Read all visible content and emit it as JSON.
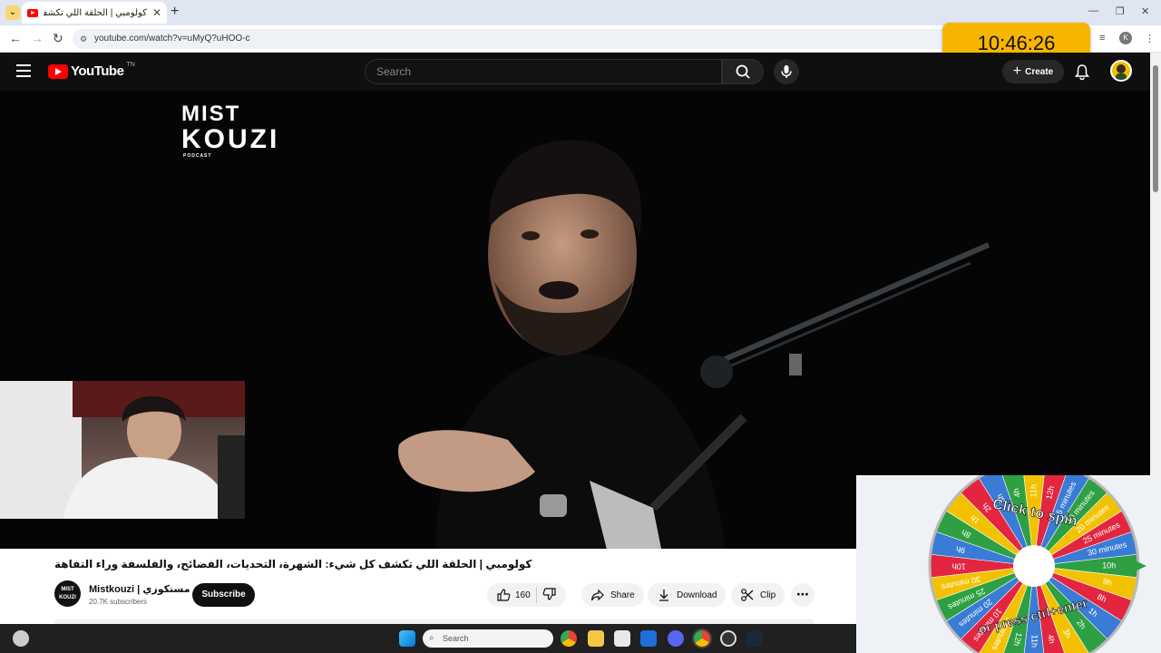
{
  "browser": {
    "tab_title": "كولومبي | الحلقة اللي تكشف كل شيء",
    "tab_close": "✕",
    "new_tab": "+",
    "url": "youtube.com/watch?v=uMyQ?uHOO-c",
    "profile_initial": "K"
  },
  "clock": {
    "time": "10:46:26"
  },
  "youtube": {
    "logo_text": "YouTube",
    "logo_badge": "TN",
    "search_placeholder": "Search",
    "create_label": "Create"
  },
  "video": {
    "watermark_line1": "MIST",
    "watermark_line2": "KOUZI",
    "watermark_line3": "PODCAST"
  },
  "details": {
    "title": "كولومبي | الحلقة اللي تكشف كل شيء: الشهرة، التحديات، الفضائح، والفلسفة وراء التفاهة",
    "channel_name": "Mistkouzi | مستكوزي",
    "channel_avatar_l1": "MIST",
    "channel_avatar_l2": "KOUZI",
    "subscribers": "20.7K subscribers",
    "subscribe_label": "Subscribe",
    "likes": "160",
    "share_label": "Share",
    "download_label": "Download",
    "clip_label": "Clip"
  },
  "wheel": {
    "top_text": "Click to spin",
    "bottom_text": "or press ctrl+enter",
    "segments": [
      "10h",
      "9h",
      "8h",
      "1h",
      "2h",
      "3h",
      "4h",
      "11h",
      "12h",
      "5 minutes",
      "10 minutes",
      "20 minutes",
      "25 minutes",
      "30 minutes"
    ]
  },
  "taskbar": {
    "search_placeholder": "Search"
  }
}
